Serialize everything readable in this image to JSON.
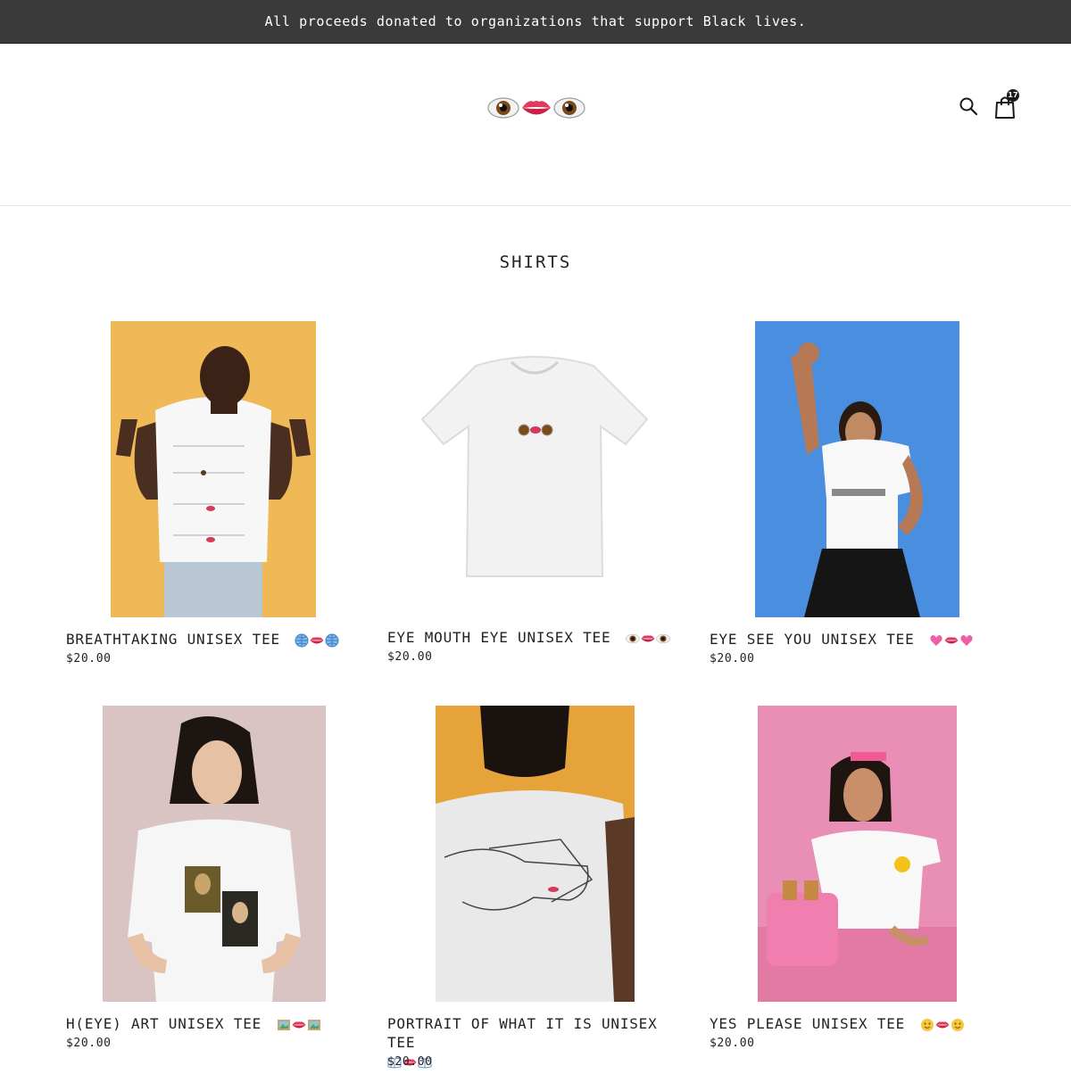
{
  "announcement": "All proceeds donated to organizations that support Black lives.",
  "header": {
    "logo_icons": [
      "eye-icon",
      "mouth-icon",
      "eye-icon"
    ],
    "search_icon": "search-icon",
    "cart_icon": "shopping-bag-icon",
    "cart_count": "17"
  },
  "collection": {
    "title": "SHIRTS",
    "products": [
      {
        "title": "BREATHTAKING UNISEX TEE",
        "emoji": [
          "globe-icon",
          "mouth-icon",
          "globe-icon"
        ],
        "price": "$20.00",
        "image_bg": "#f0b957"
      },
      {
        "title": "EYE MOUTH EYE UNISEX TEE",
        "emoji": [
          "eye-icon",
          "mouth-icon",
          "eye-icon"
        ],
        "price": "$20.00",
        "image_bg": "#ffffff"
      },
      {
        "title": "EYE SEE YOU UNISEX TEE",
        "emoji": [
          "heart-icon",
          "mouth-icon",
          "heart-icon"
        ],
        "price": "$20.00",
        "image_bg": "#4a8ee0"
      },
      {
        "title": "H(EYE) ART UNISEX TEE",
        "emoji": [
          "framed-picture-icon",
          "mouth-icon",
          "framed-picture-icon"
        ],
        "price": "$20.00",
        "image_bg": "#d9c3c3"
      },
      {
        "title": "PORTRAIT OF WHAT IT IS UNISEX TEE",
        "emoji": [
          "open-book-icon",
          "mouth-icon",
          "open-book-icon"
        ],
        "price": "$20.00",
        "image_bg": "#e6a33a"
      },
      {
        "title": "YES PLEASE UNISEX TEE",
        "emoji": [
          "smiley-icon",
          "mouth-icon",
          "smiley-icon"
        ],
        "price": "$20.00",
        "image_bg": "#e98fb5"
      }
    ]
  }
}
